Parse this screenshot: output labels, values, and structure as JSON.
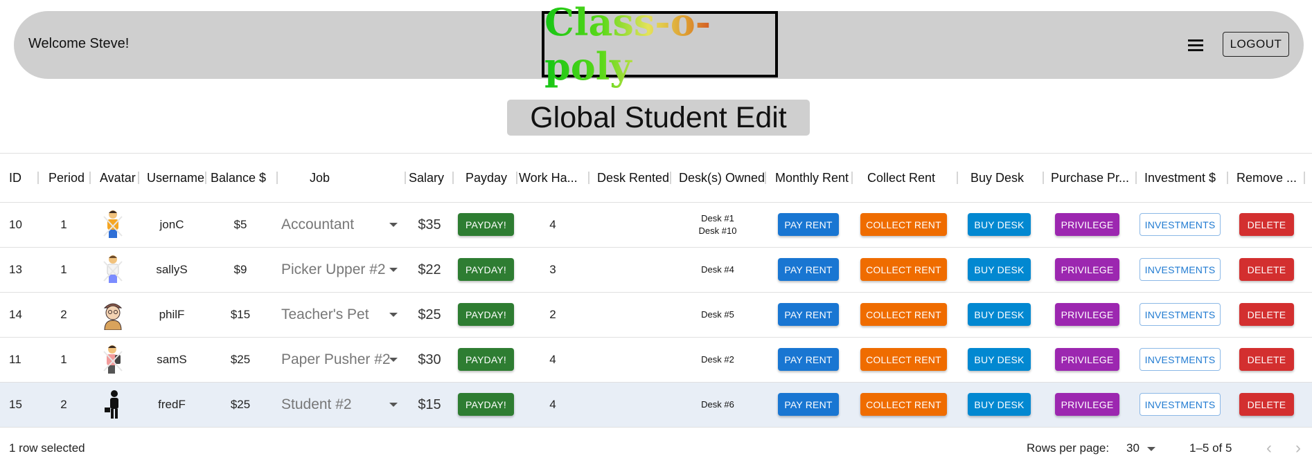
{
  "header": {
    "welcome": "Welcome Steve!",
    "logo_text": "Class-o-poly",
    "menu_icon": "hamburger-menu-icon",
    "logout_label": "LOGOUT"
  },
  "page_title": "Global Student Edit",
  "table": {
    "columns": [
      "ID",
      "Period",
      "Avatar",
      "Username",
      "Balance $",
      "Job",
      "Salary",
      "Payday",
      "Work Ha...",
      "Desk Rented",
      "Desk(s) Owned",
      "Monthly Rent",
      "Collect Rent",
      "Buy Desk",
      "Purchase Pr...",
      "Investment $",
      "Remove ..."
    ],
    "rows": [
      {
        "id": "10",
        "period": "1",
        "avatar": "student-yellow-shirt",
        "username": "jonC",
        "balance": "$5",
        "job": "Accountant",
        "salary": "$35",
        "payday": "PAYDAY!",
        "work": "4",
        "desk_rented": "",
        "desk_owned_1": "Desk #1",
        "desk_owned_2": "Desk #10",
        "pay_rent": "PAY RENT",
        "collect_rent": "COLLECT RENT",
        "buy_desk": "BUY DESK",
        "privilege": "PRIVILEGE",
        "investments": "INVESTMENTS",
        "delete": "DELETE"
      },
      {
        "id": "13",
        "period": "1",
        "avatar": "student-white-shirt",
        "username": "sallyS",
        "balance": "$9",
        "job": "Picker Upper #2",
        "salary": "$22",
        "payday": "PAYDAY!",
        "work": "3",
        "desk_rented": "",
        "desk_owned_1": "Desk #4",
        "desk_owned_2": "",
        "pay_rent": "PAY RENT",
        "collect_rent": "COLLECT RENT",
        "buy_desk": "BUY DESK",
        "privilege": "PRIVILEGE",
        "investments": "INVESTMENTS",
        "delete": "DELETE"
      },
      {
        "id": "14",
        "period": "2",
        "avatar": "student-cap-portrait",
        "username": "philF",
        "balance": "$15",
        "job": "Teacher's Pet",
        "salary": "$25",
        "payday": "PAYDAY!",
        "work": "2",
        "desk_rented": "",
        "desk_owned_1": "Desk #5",
        "desk_owned_2": "",
        "pay_rent": "PAY RENT",
        "collect_rent": "COLLECT RENT",
        "buy_desk": "BUY DESK",
        "privilege": "PRIVILEGE",
        "investments": "INVESTMENTS",
        "delete": "DELETE"
      },
      {
        "id": "11",
        "period": "1",
        "avatar": "student-backpack",
        "username": "samS",
        "balance": "$25",
        "job": "Paper Pusher #2",
        "salary": "$30",
        "payday": "PAYDAY!",
        "work": "4",
        "desk_rented": "",
        "desk_owned_1": "Desk #2",
        "desk_owned_2": "",
        "pay_rent": "PAY RENT",
        "collect_rent": "COLLECT RENT",
        "buy_desk": "BUY DESK",
        "privilege": "PRIVILEGE",
        "investments": "INVESTMENTS",
        "delete": "DELETE"
      },
      {
        "id": "15",
        "period": "2",
        "avatar": "student-silhouette",
        "username": "fredF",
        "balance": "$25",
        "job": "Student #2",
        "salary": "$15",
        "payday": "PAYDAY!",
        "work": "4",
        "desk_rented": "",
        "desk_owned_1": "Desk #6",
        "desk_owned_2": "",
        "pay_rent": "PAY RENT",
        "collect_rent": "COLLECT RENT",
        "buy_desk": "BUY DESK",
        "privilege": "PRIVILEGE",
        "investments": "INVESTMENTS",
        "delete": "DELETE",
        "selected": true
      }
    ]
  },
  "footer": {
    "selected_text": "1 row selected",
    "rows_per_page_label": "Rows per page:",
    "rows_per_page_value": "30",
    "range": "1–5 of 5"
  },
  "colors": {
    "payday": "#2e7d32",
    "pay_rent": "#1976d2",
    "collect_rent": "#ef6c00",
    "buy_desk": "#0288d1",
    "privilege": "#9c27b0",
    "delete": "#d32f2f",
    "selected_row": "#e8eef6"
  }
}
